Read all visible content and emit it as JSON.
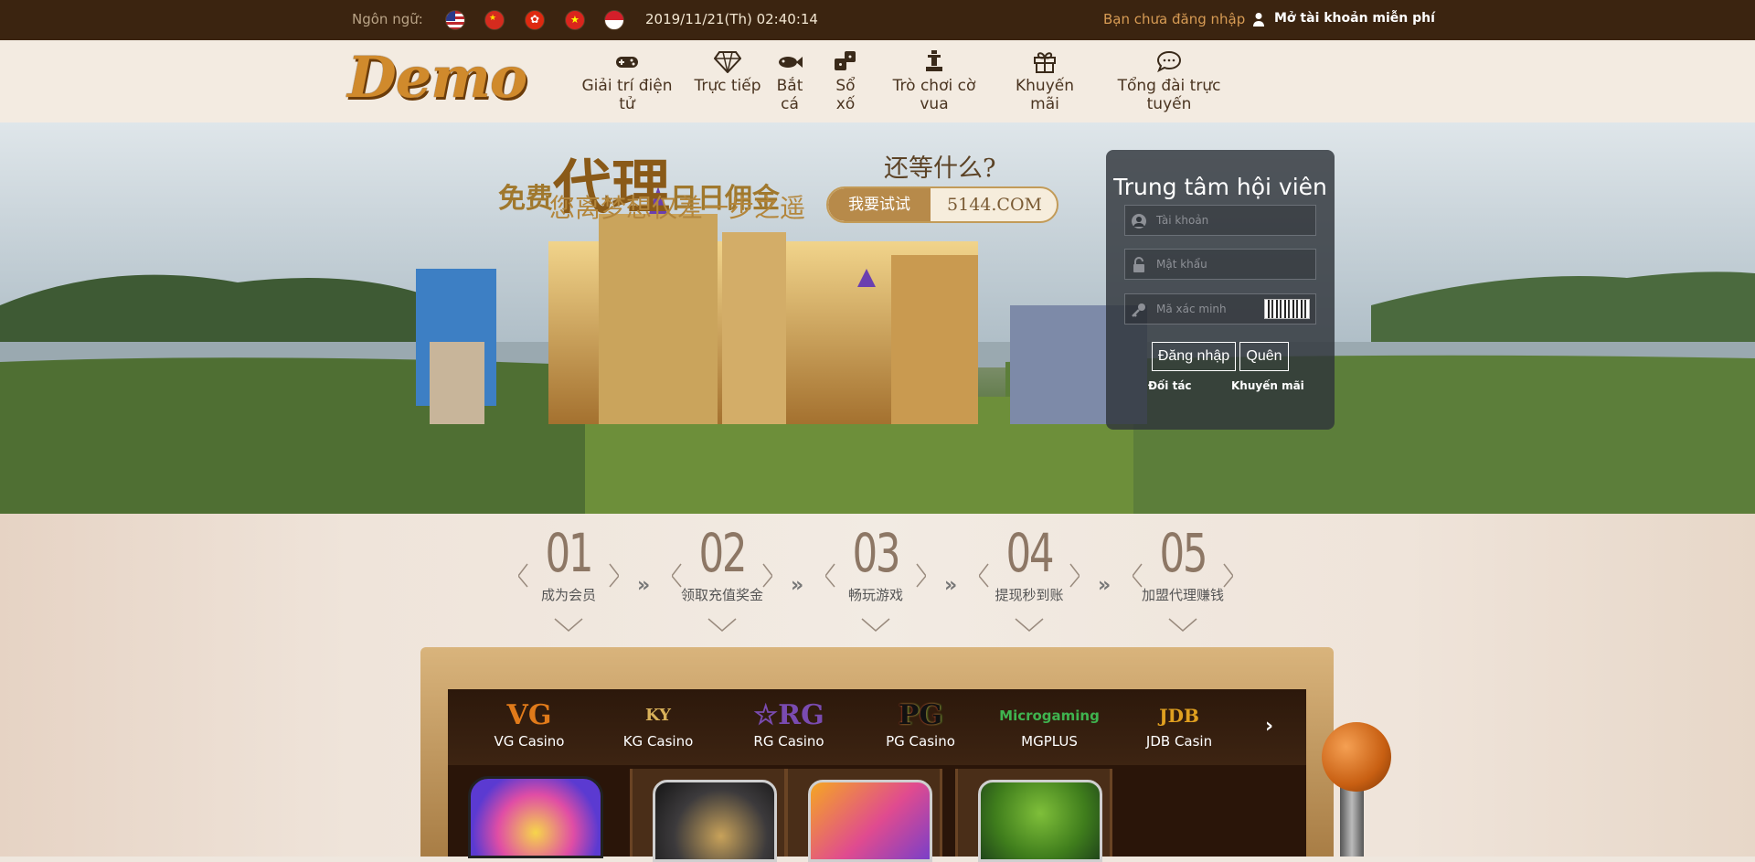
{
  "topbar": {
    "language_label": "Ngôn ngữ:",
    "flags": [
      "us-flag-icon",
      "cn-flag-icon",
      "hk-flag-icon",
      "vn-flag-icon",
      "id-flag-icon"
    ],
    "datetime": "2019/11/21(Th) 02:40:14",
    "login_status": "Bạn chưa đăng nhập",
    "register": "Mở tài khoản miễn phí"
  },
  "header": {
    "logo": "Demo",
    "nav": [
      {
        "label": "Giải trí điện tử",
        "icon": "gamepad-icon"
      },
      {
        "label": "Trực tiếp",
        "icon": "diamond-icon"
      },
      {
        "label": "Bắt cá",
        "icon": "fish-icon"
      },
      {
        "label": "Sổ xố",
        "icon": "dice-icon"
      },
      {
        "label": "Trò chơi cờ vua",
        "icon": "chess-icon"
      },
      {
        "label": "Khuyến mãi",
        "icon": "gift-icon"
      },
      {
        "label": "Tổng đài trực tuyến",
        "icon": "chat-icon"
      }
    ]
  },
  "banner": {
    "promo_line1_a": "免费",
    "promo_line1_big": "代理",
    "promo_line1_b": "日日佣金",
    "promo_line2": "您离梦想仅差一步之遥",
    "promo_question": "还等什么?",
    "try_label": "我要试试",
    "try_domain": "5144.COM"
  },
  "member": {
    "title": "Trung tâm hội viên",
    "username_placeholder": "Tài khoản",
    "password_placeholder": "Mật khẩu",
    "captcha_placeholder": "Mã xác minh",
    "login_button": "Đăng nhập",
    "forgot_button": "Quên",
    "partner_link": "Đối tác",
    "promo_link": "Khuyến mãi"
  },
  "steps": [
    {
      "num": "01",
      "label": "成为会员"
    },
    {
      "num": "02",
      "label": "领取充值奖金"
    },
    {
      "num": "03",
      "label": "畅玩游戏"
    },
    {
      "num": "04",
      "label": "提现秒到账"
    },
    {
      "num": "05",
      "label": "加盟代理赚钱"
    }
  ],
  "step_arrow": "»",
  "providers": [
    {
      "logo": "VG",
      "name": "VG Casino",
      "color": "#e07a1a"
    },
    {
      "logo": "KY",
      "name": "KG Casino",
      "color": "#d9b15a"
    },
    {
      "logo": "☆RG",
      "name": "RG Casino",
      "color": "#7a4bb0"
    },
    {
      "logo": "PG",
      "name": "PG Casino",
      "color": "#111111"
    },
    {
      "logo": "Microgaming",
      "name": "MGPLUS",
      "color": "#3fb34f"
    },
    {
      "logo": "JDB",
      "name": "JDB Casin",
      "color": "#e0a020"
    }
  ],
  "providers_next": "›",
  "games": [
    "wheel-game-icon",
    "clock-game-icon",
    "magic-game-icon",
    "tree-game-icon"
  ]
}
